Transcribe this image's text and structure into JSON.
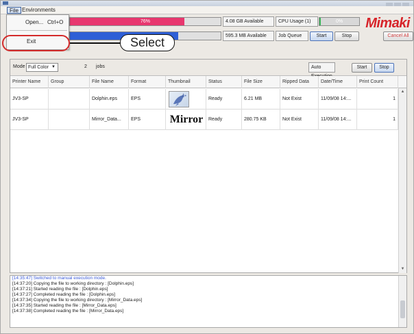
{
  "menubar": {
    "file": "File",
    "environments": "Environments"
  },
  "file_menu": {
    "open_label": "Open...",
    "open_shortcut": "Ctrl+O",
    "exit_label": "Exit"
  },
  "callout": {
    "text": "Select"
  },
  "status": {
    "memory_percent_text": "76%",
    "memory_fraction": 0.76,
    "disk_fraction": 0.72,
    "disk_available": "4.08 GB Available",
    "cpu_label": "CPU Usage (1)",
    "cpu_percent_text": "0%",
    "memory_available": "595.3 MB Available",
    "job_queue_label": "Job Queue",
    "start": "Start",
    "stop": "Stop",
    "cancel_all": "Cancel All"
  },
  "brand": {
    "logo_text": "Mimaki"
  },
  "jobs_panel": {
    "mode_label": "Mode",
    "mode_value": "Full Color",
    "job_count": "2",
    "jobs_label": "jobs",
    "auto_execution": "Auto Execution",
    "start": "Start",
    "stop": "Stop"
  },
  "table": {
    "columns": [
      "Printer Name",
      "Group",
      "File Name",
      "Format",
      "Thumbnail",
      "Status",
      "File Size",
      "Ripped Data",
      "Date/Time",
      "Print Count"
    ],
    "rows": [
      {
        "printer": "JV3-SP",
        "group": "",
        "file_name": "Dolphin.eps",
        "format": "EPS",
        "thumbnail": "dolphin-thumbnail",
        "status": "Ready",
        "file_size": "6.21 MB",
        "ripped": "Not Exist",
        "datetime": "11/09/08 14:...",
        "count": "1"
      },
      {
        "printer": "JV3-SP",
        "group": "",
        "file_name": "Mirror_Data...",
        "format": "EPS",
        "thumbnail": "Mirror",
        "status": "Ready",
        "file_size": "280.75 KB",
        "ripped": "Not Exist",
        "datetime": "11/09/08 14:...",
        "count": "1"
      }
    ]
  },
  "log": [
    "[14:35:47] Switched to manual execution mode.",
    "[14:37:20] Copying the file to working directory : [Dolphin.eps]",
    "[14:37:21] Started reading the file : [Dolphin.eps]",
    "[14:37:27] Completed reading the file : [Dolphin.eps]",
    "[14:37:34] Copying the file to working directory : [Mirror_Data.eps]",
    "[14:37:35] Started reading the file : [Mirror_Data.eps]",
    "[14:37:38] Completed reading the file : [Mirror_Data.eps]"
  ],
  "colors": {
    "memory_bar": "#e8376e",
    "disk_bar": "#2e5fd6",
    "cpu_bar": "#3db35b",
    "brand_red": "#d7242a",
    "highlight_oval": "#d42a2a",
    "log_first_line": "#3c5bd8"
  }
}
